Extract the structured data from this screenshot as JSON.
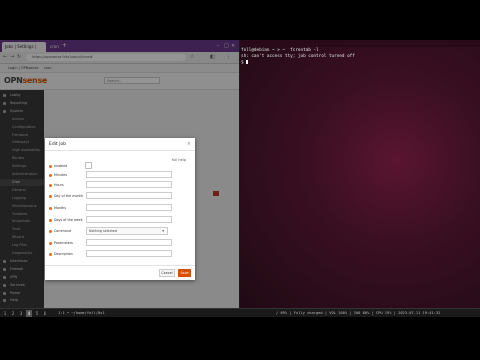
{
  "browser": {
    "tabs": [
      {
        "label": "Jobs | Settings | System | Cr"
      },
      {
        "label": "cron"
      }
    ],
    "url": "https://opnsense.fritz.box/ui/cron#",
    "bookmarks": [
      "Login | OPNsense",
      "cron"
    ],
    "search_placeholder": "Search..."
  },
  "sidebar": {
    "items": [
      {
        "label": "Lobby"
      },
      {
        "label": "Reporting"
      },
      {
        "label": "System"
      },
      {
        "label": "Access",
        "sub": true
      },
      {
        "label": "Configuration",
        "sub": true
      },
      {
        "label": "Firmware",
        "sub": true
      },
      {
        "label": "Gateways",
        "sub": true
      },
      {
        "label": "High Availability",
        "sub": true
      },
      {
        "label": "Routes",
        "sub": true
      },
      {
        "label": "Settings",
        "sub": true
      },
      {
        "label": "Administration",
        "sub": true
      },
      {
        "label": "Cron",
        "sub": true,
        "active": true
      },
      {
        "label": "General",
        "sub": true
      },
      {
        "label": "Logging",
        "sub": true
      },
      {
        "label": "Miscellaneous",
        "sub": true
      },
      {
        "label": "Tunables",
        "sub": true
      },
      {
        "label": "Snapshots",
        "sub": true
      },
      {
        "label": "Trust",
        "sub": true
      },
      {
        "label": "Wizard",
        "sub": true
      },
      {
        "label": "Log Files",
        "sub": true
      },
      {
        "label": "Diagnostics",
        "sub": true
      },
      {
        "label": "Interfaces"
      },
      {
        "label": "Firewall"
      },
      {
        "label": "VPN"
      },
      {
        "label": "Services"
      },
      {
        "label": "Power"
      },
      {
        "label": "Help"
      }
    ]
  },
  "modal": {
    "title": "Edit job",
    "help_label": "full help",
    "fields": [
      {
        "label": "enabled",
        "type": "checkbox"
      },
      {
        "label": "Minutes",
        "type": "input",
        "value": ""
      },
      {
        "label": "Hours",
        "type": "input",
        "value": ""
      },
      {
        "label": "Day of the month",
        "type": "input",
        "value": ""
      },
      {
        "label": "Months",
        "type": "input",
        "value": ""
      },
      {
        "label": "Days of the week",
        "type": "input",
        "value": ""
      },
      {
        "label": "Command",
        "type": "select",
        "value": "Nothing selected"
      },
      {
        "label": "Parameters",
        "type": "input",
        "value": ""
      },
      {
        "label": "Description",
        "type": "input",
        "value": ""
      }
    ],
    "cancel_label": "Cancel",
    "save_label": "Save"
  },
  "terminal": {
    "title": "",
    "lines": [
      "foll@debian ~ > ~  fcrontab -l",
      "sh: can't access tty; job control turned off",
      "$ "
    ]
  },
  "statusbar": {
    "workspaces": [
      "1",
      "2",
      "3",
      "4",
      "5",
      "6"
    ],
    "active_workspace": "4",
    "left_text": "1:1  •  ~/home/foll/0x1",
    "right_text": "/ 69% | Fully charged | VOL 100% | 100 80% | CPU 19% | 2023-07-11 19:41:32"
  },
  "colors": {
    "brand_orange": "#d94f00",
    "browser_tab": "#6a3b8c",
    "terminal_bg": "#3a0f22"
  }
}
